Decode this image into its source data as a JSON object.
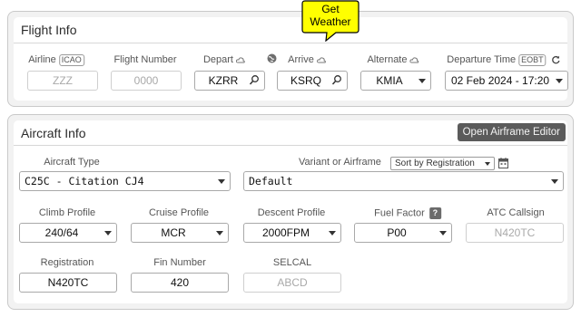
{
  "callout": {
    "line1": "Get",
    "line2": "Weather",
    "color": "#ffff00"
  },
  "flight_info": {
    "title": "Flight Info",
    "airline": {
      "label": "Airline",
      "tag": "ICAO",
      "placeholder": "ZZZ"
    },
    "flight_number": {
      "label": "Flight Number",
      "placeholder": "0000"
    },
    "depart": {
      "label": "Depart",
      "value": "KZRR"
    },
    "arrive": {
      "label": "Arrive",
      "value": "KSRQ"
    },
    "alternate": {
      "label": "Alternate",
      "value": "KMIA"
    },
    "departure_time": {
      "label": "Departure Time",
      "tag": "EOBT",
      "value": "02 Feb 2024 - 17:20"
    }
  },
  "aircraft_info": {
    "title": "Aircraft Info",
    "open_editor_label": "Open Airframe Editor",
    "aircraft_type": {
      "label": "Aircraft Type",
      "value": "C25C - Citation CJ4"
    },
    "variant": {
      "label": "Variant or Airframe",
      "sort_value": "Sort by Registration",
      "value": "Default"
    },
    "climb_profile": {
      "label": "Climb Profile",
      "value": "240/64"
    },
    "cruise_profile": {
      "label": "Cruise Profile",
      "value": "MCR"
    },
    "descent_profile": {
      "label": "Descent Profile",
      "value": "2000FPM"
    },
    "fuel_factor": {
      "label": "Fuel Factor",
      "help": "?",
      "value": "P00"
    },
    "atc_callsign": {
      "label": "ATC Callsign",
      "placeholder": "N420TC"
    },
    "registration": {
      "label": "Registration",
      "value": "N420TC"
    },
    "fin_number": {
      "label": "Fin Number",
      "value": "420"
    },
    "selcal": {
      "label": "SELCAL",
      "placeholder": "ABCD"
    }
  }
}
